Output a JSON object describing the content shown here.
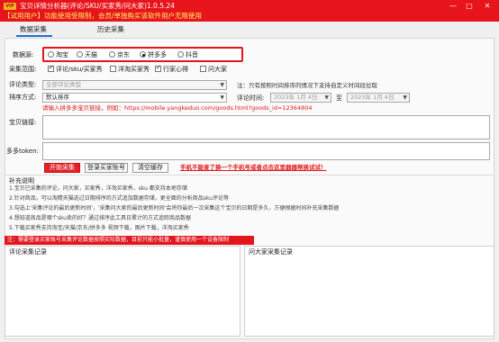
{
  "app": {
    "badge": "VIP",
    "title": "宝贝详情分析器(评论/SKU/买家秀/问大家)1.0.5.24",
    "trial_notice": "【试用用户】功能使用受限制，会员/单独购买该软件用户无限使用",
    "window_controls": [
      "—",
      "□",
      "✕"
    ]
  },
  "tabs": [
    {
      "label": "数据采集",
      "active": true
    },
    {
      "label": "历史采集",
      "active": false
    }
  ],
  "form": {
    "source_label": "数据源:",
    "sources": [
      {
        "label": "淘宝",
        "selected": false
      },
      {
        "label": "天猫",
        "selected": false
      },
      {
        "label": "京东",
        "selected": false
      },
      {
        "label": "拼多多",
        "selected": true
      },
      {
        "label": "抖音",
        "selected": false
      }
    ],
    "scope_label": "采集范围:",
    "scopes": [
      {
        "label": "评论/sku/买家秀",
        "checked": true
      },
      {
        "label": "洋淘买家秀",
        "checked": false
      },
      {
        "label": "行家心得",
        "checked": true
      },
      {
        "label": "问大家",
        "checked": false
      }
    ],
    "comment_type_label": "评论类型:",
    "comment_type_value": "全部评论类型",
    "comment_note": "注：只有按照时间排序的情况下支持自定义时间段拉取",
    "sort_label": "排序方式:",
    "sort_value": "默认排序",
    "time_label": "评论时间:",
    "date_from": "2023年 1月 4日",
    "to_label": "至",
    "date_to": "2023年 1月 4日",
    "url_hint": "请输入拼多多宝贝链接，例如：https://mobile.yangkeduo.com/goods.html?goods_id=12364804",
    "url_label": "宝贝链接:",
    "token_label": "多多token:"
  },
  "actions": {
    "start": "开始采集",
    "login": "登录买家账号",
    "clear_cache": "清空缓存",
    "promo": "手机不能查了换一个手机号或者点击这里器器帮换试试！"
  },
  "help": {
    "title": "补充说明",
    "lines": [
      "1.宝贝已采集的评论，问大家，买家秀，洋淘买家秀，sku 都支持本地存储",
      "2.针对商品，可以淘精天猫选过日期排序的方式追加数据存储，更全面的分析商品sku评论等",
      "3.勾选上'采集评论的最后更新时间'，'采集问大家的最后更新时间'会将你最后一次采集这个宝贝的日期是多久，方便根据时间补充采集数据",
      "4.想知道商品是哪个sku卖的好？通过排序此工具日累计的方式追踪商品数据",
      "5.下载买家秀支持淘宝/天猫/京东/拼多多 视频下载，图片下载，洋淘买家秀"
    ],
    "alert": "注：需要登录买家账号采集评论数据按照实际数据，目前只能小批量，谨慎使用一个设备限制"
  },
  "logs": {
    "comment_log": "评论采集记录",
    "qa_log": "问大家采集记录"
  },
  "colors": {
    "brand_red": "#e8141c",
    "tab_accent": "#1e6fd9"
  }
}
